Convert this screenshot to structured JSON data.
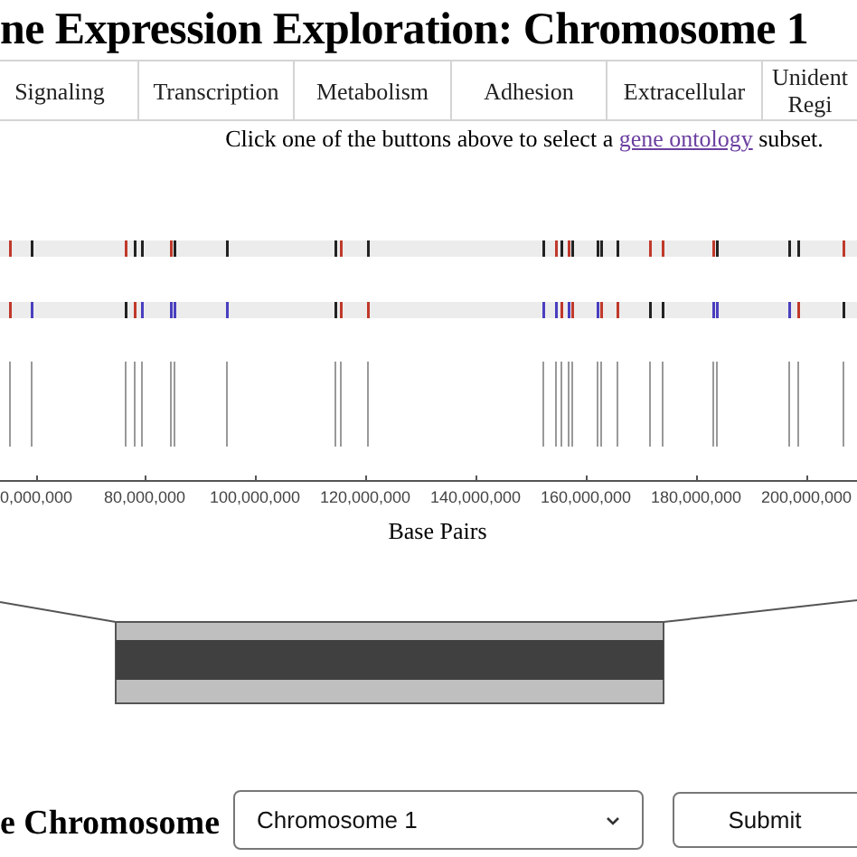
{
  "title": "ne Expression Exploration: Chromosome 1",
  "tabs": [
    {
      "label": "Signaling",
      "selected": false
    },
    {
      "label": "Transcription",
      "selected": false
    },
    {
      "label": "Metabolism",
      "selected": false
    },
    {
      "label": "Adhesion",
      "selected": false
    },
    {
      "label": "Extracellular",
      "selected": false
    },
    {
      "label": "Unident Regi",
      "selected": false
    }
  ],
  "instruction": {
    "before": "Click one of the buttons above to select a",
    "link": "gene ontology",
    "after": "subset."
  },
  "axis": {
    "label": "Base Pairs",
    "ticks": [
      "0,000,000",
      "80,000,000",
      "100,000,000",
      "120,000,000",
      "140,000,000",
      "160,000,000",
      "180,000,000",
      "200,000,000"
    ]
  },
  "chromosome_picker": {
    "label": "e Chromosome",
    "value": "Chromosome 1",
    "button": "Submit"
  }
}
